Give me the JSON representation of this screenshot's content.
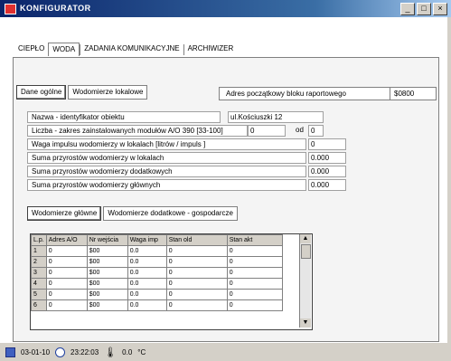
{
  "window": {
    "title": "KONFIGURATOR",
    "buttons": [
      "_",
      "□",
      "×"
    ]
  },
  "tabs": [
    "CIEPŁO",
    "WODA",
    "ZADANIA KOMUNIKACYJNE",
    "ARCHIWIZER"
  ],
  "subtabs": [
    "Dane ogólne",
    "Wodomierze lokalowe"
  ],
  "adres": {
    "label": "Adres początkowy bloku raportowego",
    "value": "$0800"
  },
  "fields": [
    {
      "label": "Nazwa - identyfikator obiektu",
      "value": "ul.Kościuszki 12"
    },
    {
      "label": "Liczba - zakres zainstalowanych modułów A/O 390 [33-100]",
      "value": "0",
      "od_label": "od",
      "od_value": "0"
    },
    {
      "label": "Waga impulsu wodomierzy w lokalach   [litrów / impuls ]",
      "value": "0"
    },
    {
      "label": "Suma przyrostów wodomierzy w lokalach",
      "value": "0.000"
    },
    {
      "label": "Suma przyrostów wodomierzy dodatkowych",
      "value": "0.000"
    },
    {
      "label": "Suma przyrostów wodomierzy głównych",
      "value": "0.000"
    }
  ],
  "lowertabs": [
    "Wodomierze główne",
    "Wodomierze dodatkowe - gospodarcze"
  ],
  "grid": {
    "headers": [
      "L.p.",
      "Adres A/O",
      "Nr wejścia",
      "Waga imp",
      "Stan old",
      "Stan akt"
    ],
    "rows": [
      [
        "1",
        "0",
        "$00",
        "0.0",
        "0",
        "0"
      ],
      [
        "2",
        "0",
        "$00",
        "0.0",
        "0",
        "0"
      ],
      [
        "3",
        "0",
        "$00",
        "0.0",
        "0",
        "0"
      ],
      [
        "4",
        "0",
        "$00",
        "0.0",
        "0",
        "0"
      ],
      [
        "5",
        "0",
        "$00",
        "0.0",
        "0",
        "0"
      ],
      [
        "6",
        "0",
        "$00",
        "0.0",
        "0",
        "0"
      ]
    ]
  },
  "taskbar": {
    "date": "03-01-10",
    "time": "23:22:03",
    "temp": "0.0",
    "temp_unit": "°C"
  }
}
